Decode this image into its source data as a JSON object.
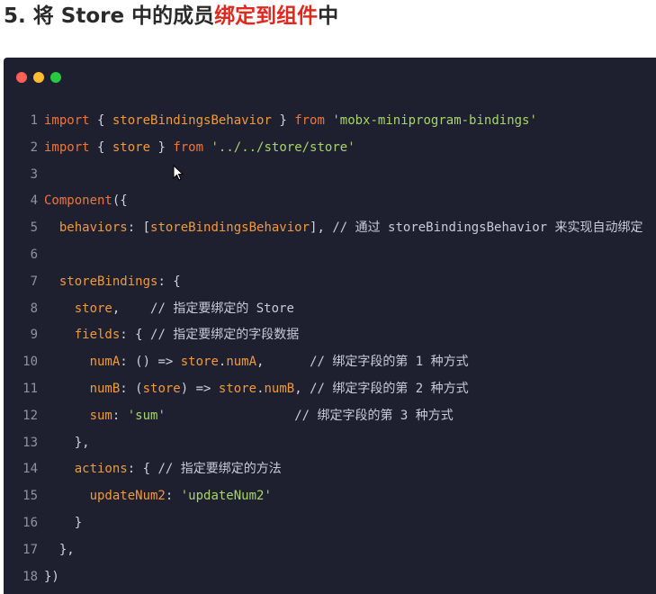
{
  "heading": {
    "prefix": "5. 将 Store 中的成员",
    "highlight": "绑定到组件",
    "suffix": "中"
  },
  "colors": {
    "editor_bg": "#1e2030",
    "keyword": "#f0753a",
    "property": "#f09a3c",
    "string": "#a7d46a",
    "text": "#cfd3dc",
    "comment": "#c7cbd6",
    "line_number": "#8e93a3",
    "heading_highlight": "#e0281e",
    "dot_red": "#ff5f57",
    "dot_yellow": "#febc2e",
    "dot_green": "#28c840"
  },
  "code_lines": [
    {
      "n": "1",
      "tokens": [
        {
          "t": "import",
          "c": "kw"
        },
        {
          "t": " { ",
          "c": "tx"
        },
        {
          "t": "storeBindingsBehavior",
          "c": "pr"
        },
        {
          "t": " } ",
          "c": "tx"
        },
        {
          "t": "from",
          "c": "kw"
        },
        {
          "t": " ",
          "c": "tx"
        },
        {
          "t": "'mobx-miniprogram-bindings'",
          "c": "st"
        }
      ]
    },
    {
      "n": "2",
      "tokens": [
        {
          "t": "import",
          "c": "kw"
        },
        {
          "t": " { ",
          "c": "tx"
        },
        {
          "t": "store",
          "c": "pr"
        },
        {
          "t": " } ",
          "c": "tx"
        },
        {
          "t": "from",
          "c": "kw"
        },
        {
          "t": " ",
          "c": "tx"
        },
        {
          "t": "'../../store/store'",
          "c": "st"
        }
      ]
    },
    {
      "n": "3",
      "tokens": []
    },
    {
      "n": "4",
      "tokens": [
        {
          "t": "Component",
          "c": "kw"
        },
        {
          "t": "({",
          "c": "tx"
        }
      ]
    },
    {
      "n": "5",
      "tokens": [
        {
          "t": "  ",
          "c": "tx"
        },
        {
          "t": "behaviors",
          "c": "pr"
        },
        {
          "t": ": [",
          "c": "tx"
        },
        {
          "t": "storeBindingsBehavior",
          "c": "pr"
        },
        {
          "t": "], ",
          "c": "tx"
        },
        {
          "t": "// 通过 storeBindingsBehavior 来实现自动绑定",
          "c": "cm"
        }
      ]
    },
    {
      "n": "6",
      "tokens": []
    },
    {
      "n": "7",
      "tokens": [
        {
          "t": "  ",
          "c": "tx"
        },
        {
          "t": "storeBindings",
          "c": "pr"
        },
        {
          "t": ": {",
          "c": "tx"
        }
      ]
    },
    {
      "n": "8",
      "tokens": [
        {
          "t": "    ",
          "c": "tx"
        },
        {
          "t": "store",
          "c": "pr"
        },
        {
          "t": ",    ",
          "c": "tx"
        },
        {
          "t": "// 指定要绑定的 Store",
          "c": "cm"
        }
      ]
    },
    {
      "n": "9",
      "tokens": [
        {
          "t": "    ",
          "c": "tx"
        },
        {
          "t": "fields",
          "c": "pr"
        },
        {
          "t": ": { ",
          "c": "tx"
        },
        {
          "t": "// 指定要绑定的字段数据",
          "c": "cm"
        }
      ]
    },
    {
      "n": "10",
      "tokens": [
        {
          "t": "      ",
          "c": "tx"
        },
        {
          "t": "numA",
          "c": "pr"
        },
        {
          "t": ": () => ",
          "c": "tx"
        },
        {
          "t": "store",
          "c": "pr"
        },
        {
          "t": ".",
          "c": "tx"
        },
        {
          "t": "numA",
          "c": "pr"
        },
        {
          "t": ",      ",
          "c": "tx"
        },
        {
          "t": "// 绑定字段的第 1 种方式",
          "c": "cm"
        }
      ]
    },
    {
      "n": "11",
      "tokens": [
        {
          "t": "      ",
          "c": "tx"
        },
        {
          "t": "numB",
          "c": "pr"
        },
        {
          "t": ": (",
          "c": "tx"
        },
        {
          "t": "store",
          "c": "pr"
        },
        {
          "t": ") => ",
          "c": "tx"
        },
        {
          "t": "store",
          "c": "pr"
        },
        {
          "t": ".",
          "c": "tx"
        },
        {
          "t": "numB",
          "c": "pr"
        },
        {
          "t": ", ",
          "c": "tx"
        },
        {
          "t": "// 绑定字段的第 2 种方式",
          "c": "cm"
        }
      ]
    },
    {
      "n": "12",
      "tokens": [
        {
          "t": "      ",
          "c": "tx"
        },
        {
          "t": "sum",
          "c": "pr"
        },
        {
          "t": ": ",
          "c": "tx"
        },
        {
          "t": "'sum'",
          "c": "st"
        },
        {
          "t": "                 ",
          "c": "tx"
        },
        {
          "t": "// 绑定字段的第 3 种方式",
          "c": "cm"
        }
      ]
    },
    {
      "n": "13",
      "tokens": [
        {
          "t": "    },",
          "c": "tx"
        }
      ]
    },
    {
      "n": "14",
      "tokens": [
        {
          "t": "    ",
          "c": "tx"
        },
        {
          "t": "actions",
          "c": "pr"
        },
        {
          "t": ": { ",
          "c": "tx"
        },
        {
          "t": "// 指定要绑定的方法",
          "c": "cm"
        }
      ]
    },
    {
      "n": "15",
      "tokens": [
        {
          "t": "      ",
          "c": "tx"
        },
        {
          "t": "updateNum2",
          "c": "pr"
        },
        {
          "t": ": ",
          "c": "tx"
        },
        {
          "t": "'updateNum2'",
          "c": "st"
        }
      ]
    },
    {
      "n": "16",
      "tokens": [
        {
          "t": "    }",
          "c": "tx"
        }
      ]
    },
    {
      "n": "17",
      "tokens": [
        {
          "t": "  },",
          "c": "tx"
        }
      ]
    },
    {
      "n": "18",
      "tokens": [
        {
          "t": "})",
          "c": "tx"
        }
      ]
    }
  ]
}
